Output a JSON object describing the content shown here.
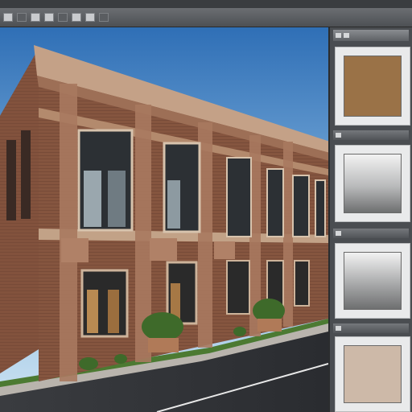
{
  "app": {
    "icons": [
      "move-tool-icon",
      "marquee-tool-icon",
      "lasso-tool-icon",
      "crop-tool-icon",
      "brush-tool-icon",
      "eraser-tool-icon",
      "text-tool-icon",
      "zoom-tool-icon"
    ]
  },
  "canvas": {
    "subject": "building-photo",
    "colors": {
      "sky_top": "#3f7fc4",
      "sky_bottom": "#bcd9ef",
      "brick": "#8a5a45",
      "trim": "#c7a88c",
      "road": "#2f3134",
      "grass": "#4c7a32"
    }
  },
  "swatches_panel": {
    "swatches": [
      {
        "name": "brown",
        "color": "#9a7247"
      },
      {
        "name": "silver-gradient",
        "color": "#b9babb"
      },
      {
        "name": "silver-gradient-2",
        "color": "#a9aaab"
      },
      {
        "name": "beige",
        "color": "#cdb9a8"
      }
    ]
  }
}
